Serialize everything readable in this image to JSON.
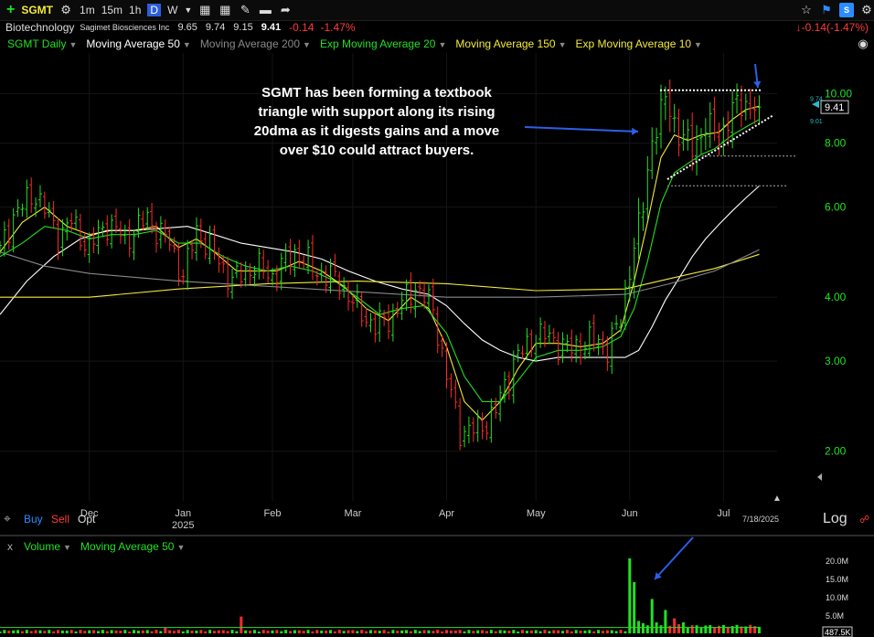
{
  "toolbar": {
    "add_label": "+",
    "symbol": "SGMT",
    "timeframes": [
      "1m",
      "15m",
      "1h",
      "D",
      "W"
    ],
    "active_timeframe": "D",
    "change_display": "-0.14(-1.47%)",
    "change_color": "#ff3b3b"
  },
  "info": {
    "sector": "Biotechnology",
    "company": "Sagimet Biosciences Inc",
    "open": "9.65",
    "high": "9.74",
    "low": "9.15",
    "close": "9.41",
    "change": "-0.14",
    "change_pct": "-1.47%"
  },
  "studies": [
    {
      "label": "SGMT Daily",
      "color": "#22e022"
    },
    {
      "label": "Moving Average 50",
      "color": "#ffffff"
    },
    {
      "label": "Moving Average 200",
      "color": "#888888"
    },
    {
      "label": "Exp Moving Average 20",
      "color": "#22e022"
    },
    {
      "label": "Moving Average 150",
      "color": "#f3ea3a"
    },
    {
      "label": "Exp Moving Average 10",
      "color": "#f3ea3a"
    }
  ],
  "annotation": {
    "lines": [
      "SGMT has been forming a textbook",
      "triangle with support along its rising",
      "20dma as it digests gains and a move",
      "over $10 could attract buyers."
    ]
  },
  "bottom": {
    "buy": "Buy",
    "sell": "Sell",
    "opt": "Opt",
    "log": "Log",
    "date_label": "7/18/2025"
  },
  "volume_panel": {
    "close_label": "x",
    "title": "Volume",
    "study": "Moving Average 50",
    "last_label": "487.5K"
  },
  "chart_data": {
    "type": "candlestick",
    "scale": "log",
    "y_ticks": [
      2.0,
      3.0,
      4.0,
      6.0,
      8.0,
      10.0
    ],
    "y_tick_labels": [
      "2.00",
      "3.00",
      "4.00",
      "6.00",
      "8.00",
      "10.00"
    ],
    "ylim": [
      1.6,
      12.0
    ],
    "x_labels": [
      {
        "label": "Dec",
        "index": 20
      },
      {
        "label": "Jan",
        "index": 41
      },
      {
        "label": "2025",
        "index": 41
      },
      {
        "label": "Feb",
        "index": 61
      },
      {
        "label": "Mar",
        "index": 79
      },
      {
        "label": "Apr",
        "index": 100
      },
      {
        "label": "May",
        "index": 120
      },
      {
        "label": "Jun",
        "index": 141
      },
      {
        "label": "Jul",
        "index": 162
      }
    ],
    "last_price": 9.41,
    "last_price_label": "9.41",
    "price_flags": [
      "9.74",
      "9.01"
    ],
    "anchors": [
      [
        0,
        4.9
      ],
      [
        3,
        5.8
      ],
      [
        8,
        6.4
      ],
      [
        13,
        5.3
      ],
      [
        16,
        5.6
      ],
      [
        20,
        5.0
      ],
      [
        24,
        5.6
      ],
      [
        28,
        5.2
      ],
      [
        33,
        5.7
      ],
      [
        38,
        5.1
      ],
      [
        41,
        4.4
      ],
      [
        44,
        5.4
      ],
      [
        47,
        5.0
      ],
      [
        52,
        4.3
      ],
      [
        57,
        4.6
      ],
      [
        61,
        4.4
      ],
      [
        66,
        4.9
      ],
      [
        71,
        4.5
      ],
      [
        76,
        4.3
      ],
      [
        79,
        3.9
      ],
      [
        84,
        3.5
      ],
      [
        88,
        3.7
      ],
      [
        93,
        4.2
      ],
      [
        97,
        3.8
      ],
      [
        100,
        2.8
      ],
      [
        103,
        2.2
      ],
      [
        107,
        2.2
      ],
      [
        111,
        2.4
      ],
      [
        115,
        3.0
      ],
      [
        118,
        3.2
      ],
      [
        120,
        3.4
      ],
      [
        124,
        3.3
      ],
      [
        128,
        3.15
      ],
      [
        132,
        3.3
      ],
      [
        136,
        3.2
      ],
      [
        139,
        3.6
      ],
      [
        141,
        4.6
      ],
      [
        144,
        6.0
      ],
      [
        146,
        8.2
      ],
      [
        149,
        9.7
      ],
      [
        152,
        8.4
      ],
      [
        155,
        7.8
      ],
      [
        158,
        8.7
      ],
      [
        161,
        8.2
      ],
      [
        164,
        9.3
      ],
      [
        167,
        9.6
      ],
      [
        170,
        9.41
      ]
    ],
    "ma_lines": [
      {
        "name": "Exp Moving Average 10",
        "color": "#f3ea3a",
        "points": [
          [
            0,
            4.9
          ],
          [
            5,
            5.6
          ],
          [
            10,
            6.0
          ],
          [
            15,
            5.5
          ],
          [
            20,
            5.3
          ],
          [
            25,
            5.4
          ],
          [
            30,
            5.4
          ],
          [
            35,
            5.5
          ],
          [
            40,
            5.0
          ],
          [
            44,
            5.2
          ],
          [
            48,
            4.9
          ],
          [
            53,
            4.5
          ],
          [
            58,
            4.5
          ],
          [
            62,
            4.5
          ],
          [
            67,
            4.7
          ],
          [
            72,
            4.5
          ],
          [
            77,
            4.2
          ],
          [
            82,
            3.8
          ],
          [
            87,
            3.6
          ],
          [
            92,
            4.0
          ],
          [
            96,
            3.8
          ],
          [
            100,
            3.2
          ],
          [
            104,
            2.5
          ],
          [
            108,
            2.3
          ],
          [
            112,
            2.5
          ],
          [
            116,
            2.9
          ],
          [
            120,
            3.25
          ],
          [
            125,
            3.25
          ],
          [
            130,
            3.2
          ],
          [
            135,
            3.25
          ],
          [
            139,
            3.45
          ],
          [
            142,
            4.3
          ],
          [
            145,
            5.6
          ],
          [
            148,
            7.5
          ],
          [
            151,
            8.3
          ],
          [
            154,
            8.1
          ],
          [
            157,
            8.3
          ],
          [
            161,
            8.4
          ],
          [
            164,
            8.9
          ],
          [
            167,
            9.3
          ],
          [
            170,
            9.45
          ]
        ]
      },
      {
        "name": "Exp Moving Average 20",
        "color": "#22e022",
        "points": [
          [
            0,
            4.8
          ],
          [
            5,
            5.1
          ],
          [
            10,
            5.5
          ],
          [
            15,
            5.4
          ],
          [
            20,
            5.2
          ],
          [
            25,
            5.3
          ],
          [
            30,
            5.3
          ],
          [
            35,
            5.4
          ],
          [
            40,
            5.1
          ],
          [
            45,
            5.1
          ],
          [
            50,
            4.8
          ],
          [
            55,
            4.6
          ],
          [
            60,
            4.5
          ],
          [
            65,
            4.6
          ],
          [
            70,
            4.5
          ],
          [
            75,
            4.3
          ],
          [
            80,
            4.0
          ],
          [
            85,
            3.7
          ],
          [
            90,
            3.8
          ],
          [
            95,
            3.85
          ],
          [
            100,
            3.4
          ],
          [
            104,
            2.8
          ],
          [
            108,
            2.5
          ],
          [
            112,
            2.5
          ],
          [
            116,
            2.75
          ],
          [
            120,
            3.05
          ],
          [
            125,
            3.15
          ],
          [
            130,
            3.15
          ],
          [
            135,
            3.2
          ],
          [
            139,
            3.35
          ],
          [
            142,
            3.8
          ],
          [
            145,
            4.7
          ],
          [
            148,
            6.1
          ],
          [
            151,
            7.0
          ],
          [
            154,
            7.3
          ],
          [
            157,
            7.6
          ],
          [
            160,
            7.8
          ],
          [
            164,
            8.3
          ],
          [
            167,
            8.6
          ],
          [
            170,
            8.9
          ]
        ]
      },
      {
        "name": "Moving Average 50",
        "color": "#ffffff",
        "points": [
          [
            0,
            3.7
          ],
          [
            6,
            4.3
          ],
          [
            12,
            4.8
          ],
          [
            18,
            5.2
          ],
          [
            24,
            5.4
          ],
          [
            30,
            5.4
          ],
          [
            36,
            5.45
          ],
          [
            42,
            5.5
          ],
          [
            48,
            5.3
          ],
          [
            54,
            5.1
          ],
          [
            60,
            5.0
          ],
          [
            66,
            4.9
          ],
          [
            72,
            4.75
          ],
          [
            78,
            4.5
          ],
          [
            84,
            4.3
          ],
          [
            90,
            4.15
          ],
          [
            96,
            4.05
          ],
          [
            100,
            3.85
          ],
          [
            104,
            3.55
          ],
          [
            108,
            3.3
          ],
          [
            112,
            3.15
          ],
          [
            116,
            3.05
          ],
          [
            120,
            3.0
          ],
          [
            125,
            3.05
          ],
          [
            130,
            3.05
          ],
          [
            135,
            3.05
          ],
          [
            140,
            3.05
          ],
          [
            143,
            3.15
          ],
          [
            146,
            3.5
          ],
          [
            149,
            3.95
          ],
          [
            152,
            4.35
          ],
          [
            155,
            4.8
          ],
          [
            158,
            5.2
          ],
          [
            161,
            5.55
          ],
          [
            164,
            5.9
          ],
          [
            167,
            6.25
          ],
          [
            170,
            6.6
          ]
        ]
      },
      {
        "name": "Moving Average 150",
        "color": "#f3ea3a",
        "points": [
          [
            0,
            4.0
          ],
          [
            20,
            4.0
          ],
          [
            40,
            4.15
          ],
          [
            60,
            4.25
          ],
          [
            80,
            4.3
          ],
          [
            100,
            4.25
          ],
          [
            120,
            4.12
          ],
          [
            140,
            4.15
          ],
          [
            150,
            4.35
          ],
          [
            160,
            4.55
          ],
          [
            170,
            4.85
          ]
        ]
      },
      {
        "name": "Moving Average 200",
        "color": "#888888",
        "points": [
          [
            0,
            4.9
          ],
          [
            10,
            4.6
          ],
          [
            20,
            4.45
          ],
          [
            40,
            4.3
          ],
          [
            60,
            4.2
          ],
          [
            80,
            4.1
          ],
          [
            100,
            4.0
          ],
          [
            120,
            4.0
          ],
          [
            140,
            4.05
          ],
          [
            150,
            4.25
          ],
          [
            160,
            4.5
          ],
          [
            170,
            4.95
          ]
        ]
      }
    ],
    "volume": {
      "y_ticks": [
        5.0,
        10.0,
        15.0,
        20.0
      ],
      "y_tick_labels": [
        "5.0M",
        "10.0M",
        "15.0M",
        "20.0M"
      ],
      "ylim": [
        0,
        22
      ],
      "spikes": [
        [
          37,
          1.6
        ],
        [
          54,
          4.6
        ],
        [
          141,
          20.5
        ],
        [
          142,
          14.0
        ],
        [
          143,
          3.4
        ],
        [
          144,
          2.8
        ],
        [
          145,
          2.2
        ],
        [
          146,
          9.4
        ],
        [
          147,
          3.0
        ],
        [
          148,
          2.2
        ],
        [
          149,
          6.4
        ],
        [
          151,
          4.1
        ],
        [
          152,
          2.5
        ],
        [
          153,
          3.0
        ]
      ],
      "baseline": 0.8,
      "ma_value": 1.6
    },
    "xlim": [
      0,
      174
    ]
  }
}
